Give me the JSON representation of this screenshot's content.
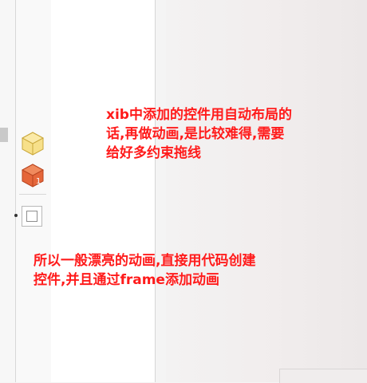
{
  "annotations": {
    "note_1_lines": [
      "xib中添加的控件用自动布局的",
      "话,再做动画,是比较难得,需要",
      "给好多约束拖线"
    ],
    "note_2_lines": [
      "所以一般漂亮的动画,直接用代码创建",
      "控件,并且通过frame添加动画"
    ]
  },
  "palette": {
    "icons": [
      "object-cube-icon",
      "view-controller-cube-icon",
      "view-square-icon"
    ],
    "colors": {
      "yellow_cube": "#f3d46a",
      "orange_cube": "#e5663a"
    }
  },
  "colors": {
    "annotation_text": "#ff1b1b",
    "canvas": "#f2eeee"
  }
}
